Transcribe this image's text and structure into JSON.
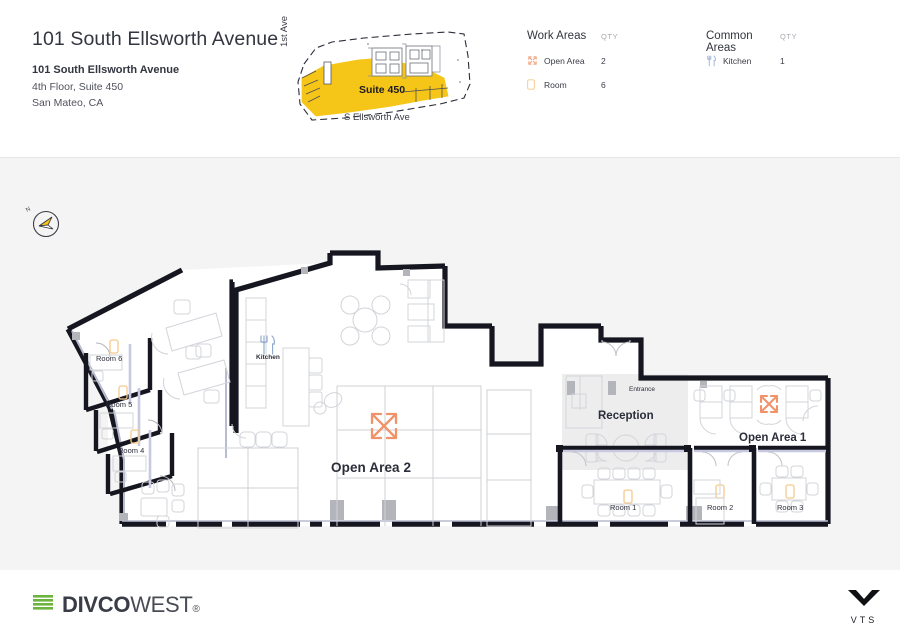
{
  "header": {
    "building_title": "101 South Ellsworth Avenue",
    "address_line_1": "101 South Ellsworth Avenue",
    "address_line_2": "4th Floor, Suite 450",
    "address_line_3": "San Mateo, CA",
    "sitemap": {
      "suite_label": "Suite 450",
      "street_left": "1st Ave",
      "street_bottom": "S Ellsworth Ave",
      "highlight_color": "#F5C518"
    },
    "legend": {
      "qty_header": "QTY",
      "groups": [
        {
          "title": "Work Areas",
          "items": [
            {
              "icon": "open-area-icon",
              "label": "Open Area",
              "qty": "2",
              "color": "#F5A985"
            },
            {
              "icon": "room-icon",
              "label": "Room",
              "qty": "6",
              "color": "#F5C98A"
            }
          ]
        },
        {
          "title": "Common Areas",
          "items": [
            {
              "icon": "kitchen-icon",
              "label": "Kitchen",
              "qty": "1",
              "color": "#9BB3D6"
            }
          ]
        }
      ]
    }
  },
  "plan": {
    "compass": {
      "label": "N",
      "arrow_color": "#F5C518"
    },
    "labels": {
      "room_6": "Room 6",
      "room_5": "Room 5",
      "room_4": "Room 4",
      "kitchen": "Kitchen",
      "open_area_2": "Open Area 2",
      "reception": "Reception",
      "entrance": "Entrance",
      "open_area_1": "Open Area 1",
      "room_1": "Room 1",
      "room_2": "Room 2",
      "room_3": "Room 3"
    },
    "colors": {
      "background": "#f4f4f4",
      "floor_fill": "#ffffff",
      "wall": "#15161f",
      "reception_fill": "#ededed",
      "furniture_stroke": "#d3d4da",
      "open_area_icon": "#F0926A",
      "room_icon": "#F5C98A",
      "kitchen_icon": "#8FA9CE"
    }
  },
  "footer": {
    "divco": {
      "bold_text": "DIVCO",
      "light_text": "WEST",
      "registered": "®",
      "bar_color": "#6DB33F"
    },
    "vts": {
      "wordmark": "VTS"
    }
  }
}
